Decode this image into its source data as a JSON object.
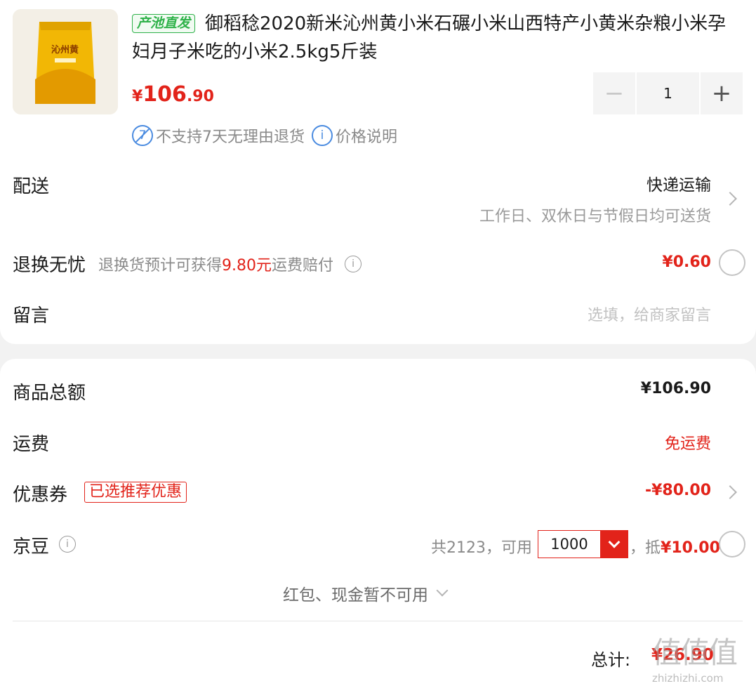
{
  "product": {
    "origin_tag": "产池直发",
    "title": "御稻稔2020新米沁州黄小米石碾小米山西特产小黄米杂粮小米孕妇月子米吃的小米2.5kg5斤装",
    "price_symbol": "¥",
    "price_int": "106",
    "price_dec": ".90",
    "quantity": "1",
    "minus_label": "−",
    "plus_label": "+",
    "no_return_text": "不支持7天无理由退货",
    "price_info_text": "价格说明",
    "image_text": "沁州黄"
  },
  "delivery": {
    "label": "配送",
    "method": "快递运输",
    "schedule": "工作日、双休日与节假日均可送货"
  },
  "return_worry": {
    "label": "退换无忧",
    "desc_prefix": "退换货预计可获得",
    "desc_amount": "9.80元",
    "desc_suffix": "运费赔付",
    "price": "¥0.60"
  },
  "message": {
    "label": "留言",
    "placeholder": "选填，给商家留言"
  },
  "summary": {
    "goods_total_label": "商品总额",
    "goods_total_value": "¥106.90",
    "shipping_label": "运费",
    "shipping_value": "免运费",
    "coupon_label": "优惠券",
    "coupon_tag": "已选推荐优惠",
    "coupon_value": "-¥80.00",
    "beans_label": "京豆",
    "beans_total": "共2123，可用",
    "beans_use": "1000",
    "beans_deduct_prefix": "，抵",
    "beans_deduct": "¥10.00",
    "redpack_text": "红包、现金暂不可用",
    "total_label": "总计:",
    "total_value": "¥26.90"
  },
  "watermark": {
    "brand": "值值值",
    "domain": "zhizhizhi.com"
  },
  "colors": {
    "accent_red": "#e2231a",
    "tag_green": "#2fb24a",
    "icon_blue": "#4a8be0"
  }
}
